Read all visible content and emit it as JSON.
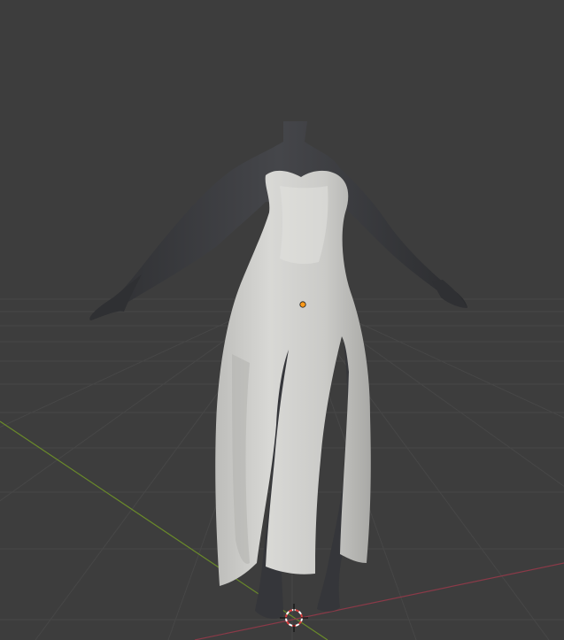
{
  "viewport": {
    "background_color": "#3d3d3d",
    "grid_color": "#474747",
    "x_axis_color": "#8a3a48",
    "y_axis_color": "#6a8a2a",
    "object_origin_color": "#ff9a1a",
    "cursor_color": "#e04040"
  },
  "scene": {
    "mannequin_color": "#3a3b3e",
    "dress_color": "#cfcfcc",
    "dress_shadow_color": "#a9a9a6",
    "icons": [
      "3d-cursor-icon",
      "object-origin-icon"
    ]
  }
}
